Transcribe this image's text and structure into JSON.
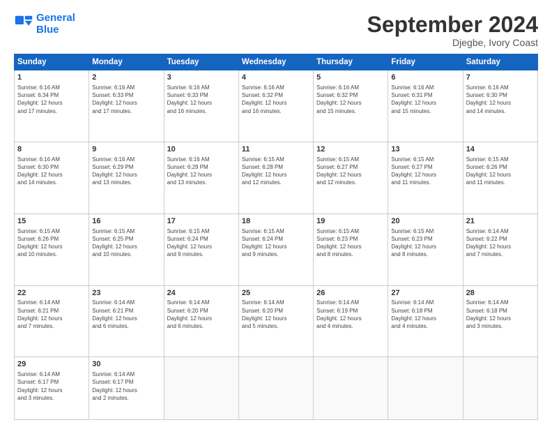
{
  "header": {
    "logo_line1": "General",
    "logo_line2": "Blue",
    "month": "September 2024",
    "location": "Djegbe, Ivory Coast"
  },
  "weekdays": [
    "Sunday",
    "Monday",
    "Tuesday",
    "Wednesday",
    "Thursday",
    "Friday",
    "Saturday"
  ],
  "weeks": [
    [
      {
        "day": "1",
        "info": "Sunrise: 6:16 AM\nSunset: 6:34 PM\nDaylight: 12 hours\nand 17 minutes."
      },
      {
        "day": "2",
        "info": "Sunrise: 6:16 AM\nSunset: 6:33 PM\nDaylight: 12 hours\nand 17 minutes."
      },
      {
        "day": "3",
        "info": "Sunrise: 6:16 AM\nSunset: 6:33 PM\nDaylight: 12 hours\nand 16 minutes."
      },
      {
        "day": "4",
        "info": "Sunrise: 6:16 AM\nSunset: 6:32 PM\nDaylight: 12 hours\nand 16 minutes."
      },
      {
        "day": "5",
        "info": "Sunrise: 6:16 AM\nSunset: 6:32 PM\nDaylight: 12 hours\nand 15 minutes."
      },
      {
        "day": "6",
        "info": "Sunrise: 6:16 AM\nSunset: 6:31 PM\nDaylight: 12 hours\nand 15 minutes."
      },
      {
        "day": "7",
        "info": "Sunrise: 6:16 AM\nSunset: 6:30 PM\nDaylight: 12 hours\nand 14 minutes."
      }
    ],
    [
      {
        "day": "8",
        "info": "Sunrise: 6:16 AM\nSunset: 6:30 PM\nDaylight: 12 hours\nand 14 minutes."
      },
      {
        "day": "9",
        "info": "Sunrise: 6:16 AM\nSunset: 6:29 PM\nDaylight: 12 hours\nand 13 minutes."
      },
      {
        "day": "10",
        "info": "Sunrise: 6:16 AM\nSunset: 6:29 PM\nDaylight: 12 hours\nand 13 minutes."
      },
      {
        "day": "11",
        "info": "Sunrise: 6:15 AM\nSunset: 6:28 PM\nDaylight: 12 hours\nand 12 minutes."
      },
      {
        "day": "12",
        "info": "Sunrise: 6:15 AM\nSunset: 6:27 PM\nDaylight: 12 hours\nand 12 minutes."
      },
      {
        "day": "13",
        "info": "Sunrise: 6:15 AM\nSunset: 6:27 PM\nDaylight: 12 hours\nand 11 minutes."
      },
      {
        "day": "14",
        "info": "Sunrise: 6:15 AM\nSunset: 6:26 PM\nDaylight: 12 hours\nand 11 minutes."
      }
    ],
    [
      {
        "day": "15",
        "info": "Sunrise: 6:15 AM\nSunset: 6:26 PM\nDaylight: 12 hours\nand 10 minutes."
      },
      {
        "day": "16",
        "info": "Sunrise: 6:15 AM\nSunset: 6:25 PM\nDaylight: 12 hours\nand 10 minutes."
      },
      {
        "day": "17",
        "info": "Sunrise: 6:15 AM\nSunset: 6:24 PM\nDaylight: 12 hours\nand 9 minutes."
      },
      {
        "day": "18",
        "info": "Sunrise: 6:15 AM\nSunset: 6:24 PM\nDaylight: 12 hours\nand 9 minutes."
      },
      {
        "day": "19",
        "info": "Sunrise: 6:15 AM\nSunset: 6:23 PM\nDaylight: 12 hours\nand 8 minutes."
      },
      {
        "day": "20",
        "info": "Sunrise: 6:15 AM\nSunset: 6:23 PM\nDaylight: 12 hours\nand 8 minutes."
      },
      {
        "day": "21",
        "info": "Sunrise: 6:14 AM\nSunset: 6:22 PM\nDaylight: 12 hours\nand 7 minutes."
      }
    ],
    [
      {
        "day": "22",
        "info": "Sunrise: 6:14 AM\nSunset: 6:21 PM\nDaylight: 12 hours\nand 7 minutes."
      },
      {
        "day": "23",
        "info": "Sunrise: 6:14 AM\nSunset: 6:21 PM\nDaylight: 12 hours\nand 6 minutes."
      },
      {
        "day": "24",
        "info": "Sunrise: 6:14 AM\nSunset: 6:20 PM\nDaylight: 12 hours\nand 6 minutes."
      },
      {
        "day": "25",
        "info": "Sunrise: 6:14 AM\nSunset: 6:20 PM\nDaylight: 12 hours\nand 5 minutes."
      },
      {
        "day": "26",
        "info": "Sunrise: 6:14 AM\nSunset: 6:19 PM\nDaylight: 12 hours\nand 4 minutes."
      },
      {
        "day": "27",
        "info": "Sunrise: 6:14 AM\nSunset: 6:18 PM\nDaylight: 12 hours\nand 4 minutes."
      },
      {
        "day": "28",
        "info": "Sunrise: 6:14 AM\nSunset: 6:18 PM\nDaylight: 12 hours\nand 3 minutes."
      }
    ],
    [
      {
        "day": "29",
        "info": "Sunrise: 6:14 AM\nSunset: 6:17 PM\nDaylight: 12 hours\nand 3 minutes."
      },
      {
        "day": "30",
        "info": "Sunrise: 6:14 AM\nSunset: 6:17 PM\nDaylight: 12 hours\nand 2 minutes."
      },
      {
        "day": "",
        "info": ""
      },
      {
        "day": "",
        "info": ""
      },
      {
        "day": "",
        "info": ""
      },
      {
        "day": "",
        "info": ""
      },
      {
        "day": "",
        "info": ""
      }
    ]
  ]
}
